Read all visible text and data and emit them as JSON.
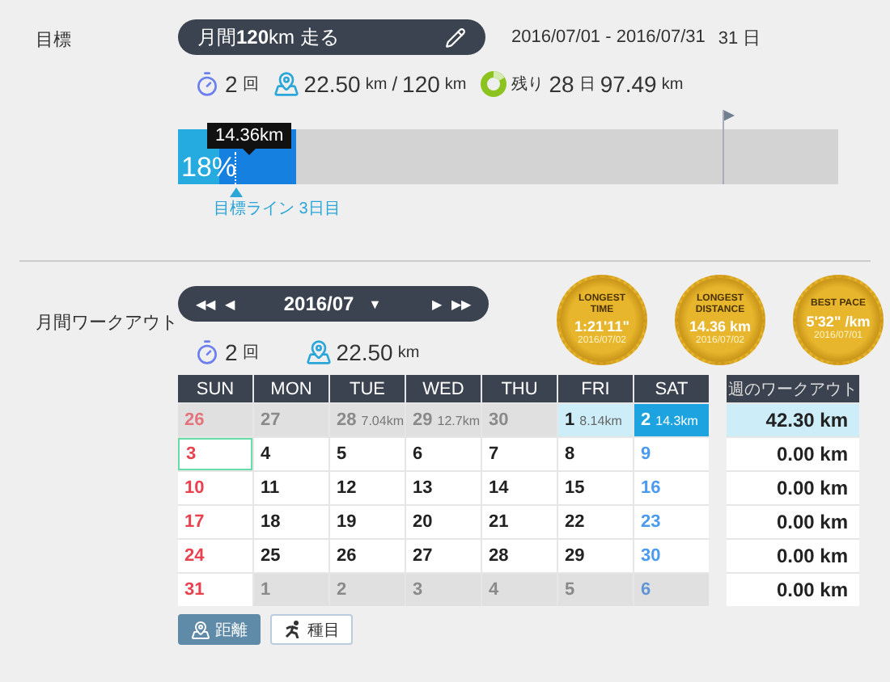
{
  "goal": {
    "label": "目標",
    "title": "月間**120**km 走る",
    "period": "2016/07/01 - 2016/07/31",
    "days": "31 日",
    "stats": {
      "count": "2",
      "count_unit": "回",
      "distance": "22.50",
      "distance_unit": "km",
      "separator": "/",
      "target": "120",
      "target_unit": "km",
      "remaining_label": "残り",
      "remaining_days": "28",
      "days_unit": "日",
      "remaining_distance": "97.49",
      "remaining_unit": "km"
    },
    "progress": {
      "level": 0.18,
      "percent": "18%",
      "tooltip": "14.36km",
      "target_line": "目標ライン 3日目"
    }
  },
  "workout": {
    "label": "月間ワークアウト",
    "nav": {
      "prev_year": "◀◀",
      "prev_month": "◀",
      "dropdown": "▼",
      "next_month": "▶",
      "next_year": "▶▶"
    },
    "month": "2016/07",
    "stats": {
      "count": "2",
      "count_unit": "回",
      "distance": "22.50",
      "distance_unit": "km"
    },
    "medals": [
      {
        "title": "LONGEST TIME",
        "value": "1:21'11\"",
        "date": "2016/07/02"
      },
      {
        "title": "LONGEST DISTANCE",
        "value": "14.36 km",
        "date": "2016/07/02"
      },
      {
        "title": "BEST PACE",
        "value": "5'32\" /km",
        "date": "2016/07/01"
      }
    ],
    "weekdays": [
      "SUN",
      "MON",
      "TUE",
      "WED",
      "THU",
      "FRI",
      "SAT"
    ],
    "weeks": [
      {
        "selected": true,
        "days": [
          {
            "day": "26",
            "outside": true,
            "today": false,
            "selected": false
          },
          {
            "day": "27",
            "outside": true,
            "today": false,
            "selected": false
          },
          {
            "day": "28",
            "outside": true,
            "today": false,
            "selected": false,
            "distance": "7.04",
            "unit": "km"
          },
          {
            "day": "29",
            "outside": true,
            "today": false,
            "selected": false,
            "distance": "12.7",
            "unit": "km"
          },
          {
            "day": "30",
            "outside": true,
            "today": false,
            "selected": false
          },
          {
            "day": "1",
            "outside": false,
            "today": false,
            "selected": false,
            "distance": "8.14",
            "unit": "km"
          },
          {
            "day": "2",
            "outside": false,
            "today": false,
            "selected": true,
            "distance": "14.3",
            "unit": "km"
          }
        ]
      },
      {
        "selected": false,
        "days": [
          {
            "day": "3",
            "outside": false,
            "today": true,
            "selected": false
          },
          {
            "day": "4",
            "outside": false,
            "today": false,
            "selected": false
          },
          {
            "day": "5",
            "outside": false,
            "today": false,
            "selected": false
          },
          {
            "day": "6",
            "outside": false,
            "today": false,
            "selected": false
          },
          {
            "day": "7",
            "outside": false,
            "today": false,
            "selected": false
          },
          {
            "day": "8",
            "outside": false,
            "today": false,
            "selected": false
          },
          {
            "day": "9",
            "outside": false,
            "today": false,
            "selected": false
          }
        ]
      },
      {
        "selected": false,
        "days": [
          {
            "day": "10",
            "outside": false,
            "today": false,
            "selected": false
          },
          {
            "day": "11",
            "outside": false,
            "today": false,
            "selected": false
          },
          {
            "day": "12",
            "outside": false,
            "today": false,
            "selected": false
          },
          {
            "day": "13",
            "outside": false,
            "today": false,
            "selected": false
          },
          {
            "day": "14",
            "outside": false,
            "today": false,
            "selected": false
          },
          {
            "day": "15",
            "outside": false,
            "today": false,
            "selected": false
          },
          {
            "day": "16",
            "outside": false,
            "today": false,
            "selected": false
          }
        ]
      },
      {
        "selected": false,
        "days": [
          {
            "day": "17",
            "outside": false,
            "today": false,
            "selected": false
          },
          {
            "day": "18",
            "outside": false,
            "today": false,
            "selected": false
          },
          {
            "day": "19",
            "outside": false,
            "today": false,
            "selected": false
          },
          {
            "day": "20",
            "outside": false,
            "today": false,
            "selected": false
          },
          {
            "day": "21",
            "outside": false,
            "today": false,
            "selected": false
          },
          {
            "day": "22",
            "outside": false,
            "today": false,
            "selected": false
          },
          {
            "day": "23",
            "outside": false,
            "today": false,
            "selected": false
          }
        ]
      },
      {
        "selected": false,
        "days": [
          {
            "day": "24",
            "outside": false,
            "today": false,
            "selected": false
          },
          {
            "day": "25",
            "outside": false,
            "today": false,
            "selected": false
          },
          {
            "day": "26",
            "outside": false,
            "today": false,
            "selected": false
          },
          {
            "day": "27",
            "outside": false,
            "today": false,
            "selected": false
          },
          {
            "day": "28",
            "outside": false,
            "today": false,
            "selected": false
          },
          {
            "day": "29",
            "outside": false,
            "today": false,
            "selected": false
          },
          {
            "day": "30",
            "outside": false,
            "today": false,
            "selected": false
          }
        ]
      },
      {
        "selected": false,
        "days": [
          {
            "day": "31",
            "outside": false,
            "today": false,
            "selected": false
          },
          {
            "day": "1",
            "outside": true,
            "today": false,
            "selected": false
          },
          {
            "day": "2",
            "outside": true,
            "today": false,
            "selected": false
          },
          {
            "day": "3",
            "outside": true,
            "today": false,
            "selected": false
          },
          {
            "day": "4",
            "outside": true,
            "today": false,
            "selected": false
          },
          {
            "day": "5",
            "outside": true,
            "today": false,
            "selected": false
          },
          {
            "day": "6",
            "outside": true,
            "today": false,
            "selected": false
          }
        ]
      }
    ],
    "weekly": {
      "title": "週のワークアウト",
      "rows": [
        {
          "value": "42.30 km",
          "selected": true
        },
        {
          "value": "0.00 km",
          "selected": false
        },
        {
          "value": "0.00 km",
          "selected": false
        },
        {
          "value": "0.00 km",
          "selected": false
        },
        {
          "value": "0.00 km",
          "selected": false
        },
        {
          "value": "0.00 km",
          "selected": false
        }
      ]
    },
    "views": [
      {
        "label": "距離",
        "kind": "distance",
        "selected": true
      },
      {
        "label": "種目",
        "kind": "activity",
        "selected": false
      }
    ]
  }
}
